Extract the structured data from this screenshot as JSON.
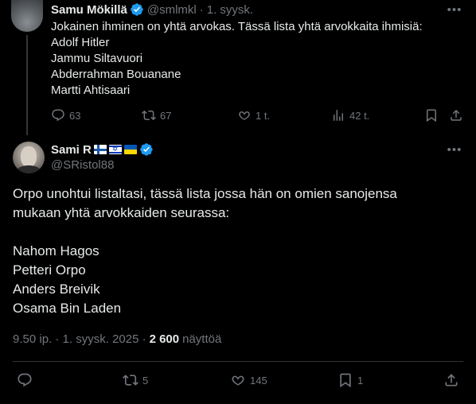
{
  "parent_tweet": {
    "display_name": "Samu Mökillä",
    "handle": "@smlmkl",
    "separator": "·",
    "time": "1. syysk.",
    "lines": [
      "Jokainen ihminen on yhtä arvokas. Tässä lista yhtä arvokkaita ihmisiä:",
      "Adolf Hitler",
      "Jammu Siltavuori",
      "Abderrahman Bouanane",
      "Martti Ahtisaari"
    ],
    "stats": {
      "replies": "63",
      "reposts": "67",
      "likes": "1 t.",
      "views": "42 t."
    }
  },
  "main_tweet": {
    "display_name": "Sami R",
    "handle": "@SRistol88",
    "flags": [
      "finland-flag",
      "israel-flag",
      "ukraine-flag"
    ],
    "lines": [
      "Orpo unohtui listaltasi, tässä lista jossa hän on omien sanojensa",
      "mukaan yhtä arvokkaiden seurassa:",
      "",
      "Nahom Hagos",
      "Petteri Orpo",
      "Anders Breivik",
      "Osama Bin Laden"
    ],
    "timestamp": "9.50 ip. · 1. syysk. 2025 ·",
    "views_count": "2 600",
    "views_label": "näyttöä",
    "stats": {
      "replies": "",
      "reposts": "5",
      "likes": "145",
      "bookmarks": "1"
    }
  },
  "colors": {
    "background": "#000000",
    "text": "#e7e9ea",
    "muted": "#71767b",
    "verified": "#1d9bf0",
    "divider": "#2f3336"
  },
  "icons": [
    "more-icon",
    "verified-badge-icon",
    "reply-icon",
    "repost-icon",
    "like-icon",
    "views-icon",
    "bookmark-icon",
    "share-icon"
  ]
}
